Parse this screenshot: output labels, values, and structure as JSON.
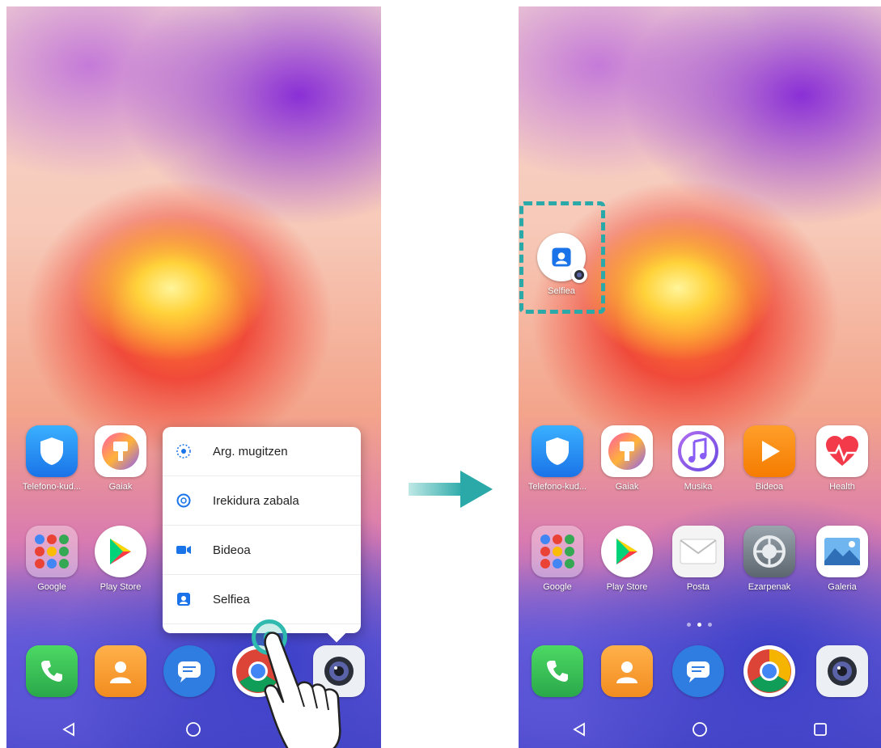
{
  "left_screen": {
    "row1": [
      {
        "label": "Telefono-kud...",
        "icon": "shield-icon"
      },
      {
        "label": "Gaiak",
        "icon": "themes-icon"
      }
    ],
    "row2": [
      {
        "label": "Google",
        "icon": "google-folder-icon"
      },
      {
        "label": "Play Store",
        "icon": "play-store-icon"
      }
    ],
    "dock": [
      {
        "icon": "phone-icon"
      },
      {
        "icon": "contacts-icon"
      },
      {
        "icon": "messages-icon"
      },
      {
        "icon": "chrome-icon"
      },
      {
        "icon": "camera-icon"
      }
    ],
    "popup_menu": [
      {
        "label": "Arg. mugitzen",
        "icon": "timelapse-icon"
      },
      {
        "label": "Irekidura zabala",
        "icon": "aperture-icon"
      },
      {
        "label": "Bideoa",
        "icon": "video-icon"
      },
      {
        "label": "Selfiea",
        "icon": "selfie-icon"
      }
    ]
  },
  "right_screen": {
    "shortcut": {
      "label": "Selfiea",
      "icon": "selfie-icon"
    },
    "row1": [
      {
        "label": "Telefono-kud...",
        "icon": "shield-icon"
      },
      {
        "label": "Gaiak",
        "icon": "themes-icon"
      },
      {
        "label": "Musika",
        "icon": "music-icon"
      },
      {
        "label": "Bideoa",
        "icon": "video-player-icon"
      },
      {
        "label": "Health",
        "icon": "health-icon"
      }
    ],
    "row2": [
      {
        "label": "Google",
        "icon": "google-folder-icon"
      },
      {
        "label": "Play Store",
        "icon": "play-store-icon"
      },
      {
        "label": "Posta",
        "icon": "mail-icon"
      },
      {
        "label": "Ezarpenak",
        "icon": "settings-icon"
      },
      {
        "label": "Galeria",
        "icon": "gallery-icon"
      }
    ],
    "dock": [
      {
        "icon": "phone-icon"
      },
      {
        "icon": "contacts-icon"
      },
      {
        "icon": "messages-icon"
      },
      {
        "icon": "chrome-icon"
      },
      {
        "icon": "camera-icon"
      }
    ]
  },
  "colors": {
    "accent": "#2aa9a8",
    "popup_icon": "#1a73e8"
  }
}
